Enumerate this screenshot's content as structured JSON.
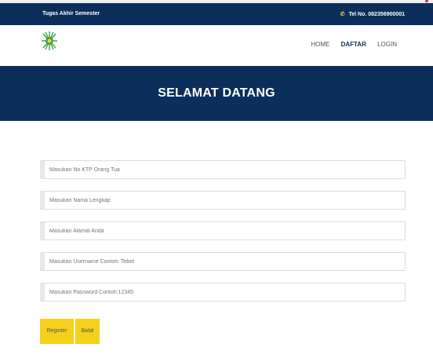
{
  "topbar": {
    "left_text": "Tugas Akhir Semester",
    "phone_text": "Tel No. 082356900001"
  },
  "nav": {
    "home": "HOME",
    "daftar": "DAFTAR",
    "login": "LOGIN"
  },
  "hero": {
    "title": "SELAMAT DATANG"
  },
  "form": {
    "ktp_placeholder": "Masukan No KTP Orang Tua",
    "name_placeholder": "Masukan Nama Lengkap",
    "address_placeholder": "Masukan Alamat Anda",
    "username_placeholder": "Masukan Username Contoh: Tebet",
    "password_placeholder": "Masukan Password Contoh:12345"
  },
  "buttons": {
    "register": "Register",
    "batal": "Batal"
  },
  "colors": {
    "navy": "#0b2e5a",
    "yellow": "#f5d11d",
    "logo_green": "#3aa44a"
  }
}
